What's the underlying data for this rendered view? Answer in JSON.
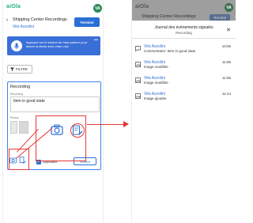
{
  "left": {
    "logo": "aiOla",
    "avatar": "VA",
    "header": {
      "back_glyph": "‹",
      "title": "Shipping Center Recordings",
      "subtitle": "Vito Azzolini",
      "done_button": "Terminé"
    },
    "banner": {
      "text": "Appuyez sur le bouton du haut-parleur pour lancer la tâche avec votre voix",
      "menu_glyph": "•••"
    },
    "filter_button": "FILTRE",
    "card": {
      "title": "Recording",
      "field_label": "Recording",
      "field_value": "Item in good state",
      "photos_label": "Photos",
      "checkbox_label": "Applicable",
      "done_button": "Terminé"
    }
  },
  "right": {
    "logo": "aiOla",
    "avatar": "VA",
    "background_title": "Shipping Center Recordings",
    "background_button": "Terminé",
    "sheet": {
      "title": "Journal des événements signalés",
      "subtitle": "Recording",
      "close_glyph": "✕",
      "items": [
        {
          "icon": "comment-icon",
          "name": "Vito Azzolini",
          "desc": "Commentaire: Item in good state",
          "time": "10:06"
        },
        {
          "icon": "image-icon",
          "name": "Vito Azzolini",
          "desc": "Image modifiée",
          "time": "11:55"
        },
        {
          "icon": "image-icon",
          "name": "Vito Azzolini",
          "desc": "Image modifiée",
          "time": "11:55"
        },
        {
          "icon": "image-icon",
          "name": "Vito Azzolini",
          "desc": "Image ajoutée",
          "time": "11:44"
        }
      ]
    }
  },
  "colors": {
    "brand_green": "#2bb27a",
    "primary_blue": "#2a6fd6",
    "annotation_red": "#e53935"
  }
}
